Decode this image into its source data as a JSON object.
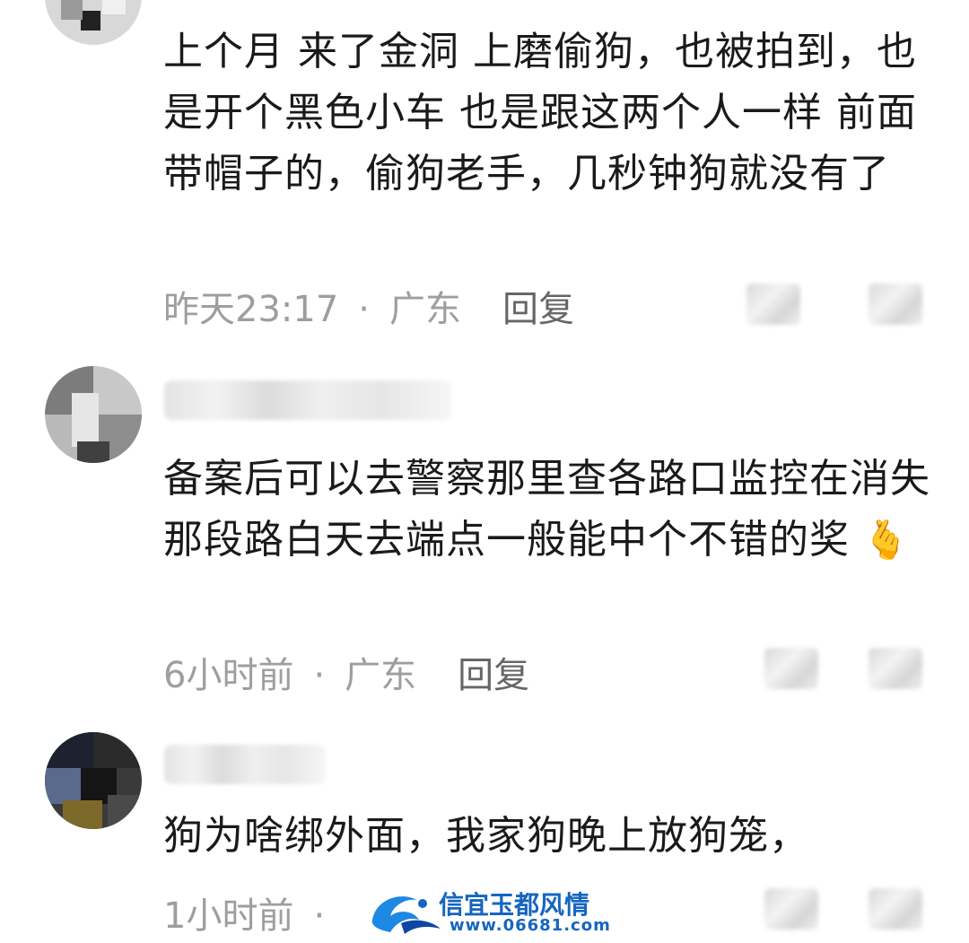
{
  "comments": [
    {
      "text": "上个月 来了金洞 上磨偷狗，也被拍到，也是开个黑色小车 也是跟这两个人一样 前面带帽子的，偷狗老手，几秒钟狗就没有了",
      "time": "昨天23:17",
      "location": "广东",
      "reply_label": "回复"
    },
    {
      "text": "备案后可以去警察那里查各路口监控在消失那段路白天去端点一般能中个不错的奖",
      "emoji": "🫰",
      "time": "6小时前",
      "location": "广东",
      "reply_label": "回复"
    },
    {
      "text": "狗为啥绑外面，我家狗晚上放狗笼，",
      "time": "1小时前"
    }
  ],
  "meta_separator": "·",
  "watermark": {
    "title": "信宜玉都风情",
    "url": "www.06681.com"
  }
}
